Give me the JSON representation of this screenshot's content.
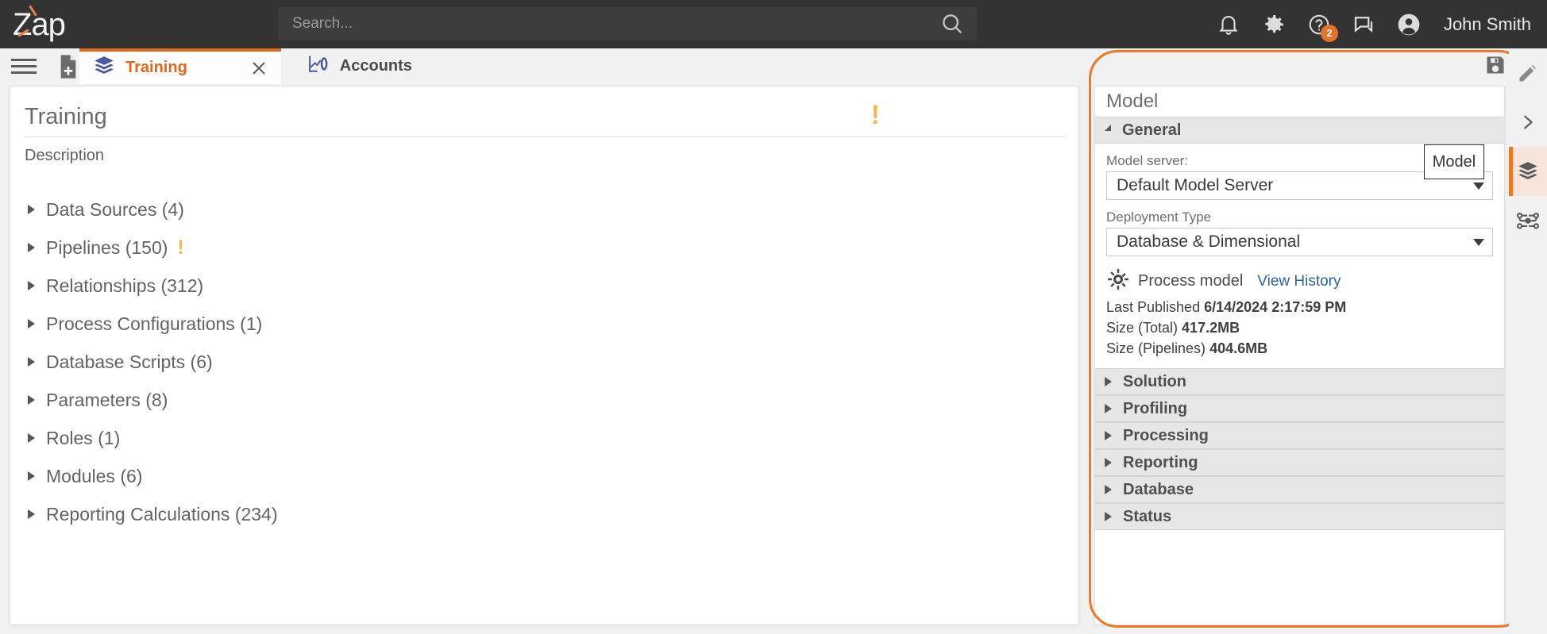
{
  "app": {
    "logo_text": "Zap"
  },
  "search": {
    "placeholder": "Search...",
    "value": "",
    "icon": "search-icon"
  },
  "topbar": {
    "notifications_icon": "bell-icon",
    "settings_icon": "gear-icon",
    "help_icon": "help-circle-icon",
    "help_badge": "2",
    "chat_icon": "chat-icon",
    "avatar_icon": "user-avatar-icon",
    "username": "John Smith"
  },
  "tabbar": {
    "menu_icon": "hamburger-menu-icon",
    "new_icon": "new-document-icon",
    "tabs": [
      {
        "label": "Training",
        "icon": "layers-icon",
        "active": true,
        "close_icon": "close-icon"
      },
      {
        "label": "Accounts",
        "icon": "chart-icon",
        "active": false
      }
    ]
  },
  "main": {
    "title": "Training",
    "title_warning": "!",
    "description": "Description",
    "tree": [
      {
        "label": "Data Sources (4)"
      },
      {
        "label": "Pipelines (150)",
        "warning": "!"
      },
      {
        "label": "Relationships (312)"
      },
      {
        "label": "Process Configurations (1)"
      },
      {
        "label": "Database Scripts (6)"
      },
      {
        "label": "Parameters (8)"
      },
      {
        "label": "Roles (1)"
      },
      {
        "label": "Modules (6)"
      },
      {
        "label": "Reporting Calculations (234)"
      }
    ]
  },
  "panel": {
    "title": "Model",
    "save_icon": "save-floppy-icon",
    "more_icon": "more-vertical-icon",
    "general": {
      "header": "General",
      "model_server_label": "Model server:",
      "model_server_value": "Default Model Server",
      "deployment_type_label": "Deployment Type",
      "deployment_type_value": "Database & Dimensional",
      "process_model_icon": "gear-icon",
      "process_model_label": "Process model",
      "view_history_link": "View History",
      "stats": [
        {
          "label": "Last Published",
          "value": "6/14/2024 2:17:59 PM"
        },
        {
          "label": "Size (Total)",
          "value": "417.2MB"
        },
        {
          "label": "Size (Pipelines)",
          "value": "404.6MB"
        }
      ]
    },
    "sections": [
      {
        "label": "Solution"
      },
      {
        "label": "Profiling"
      },
      {
        "label": "Processing"
      },
      {
        "label": "Reporting"
      },
      {
        "label": "Database"
      },
      {
        "label": "Status"
      }
    ]
  },
  "tooltip": {
    "text": "Model"
  },
  "rail": {
    "items": [
      {
        "icon": "pencil-edit-icon",
        "active": false
      },
      {
        "icon": "chevron-right-icon",
        "active": false
      },
      {
        "icon": "layers-icon",
        "active": true
      },
      {
        "icon": "flow-nodes-icon",
        "active": false
      }
    ]
  },
  "colors": {
    "accent_orange": "#ef7622",
    "tab_orange": "#e2671a",
    "warning_amber": "#edbb5c",
    "link_blue": "#2f5fa8",
    "topbar_dark": "#333333",
    "layers_blue": "#4a56a6"
  }
}
